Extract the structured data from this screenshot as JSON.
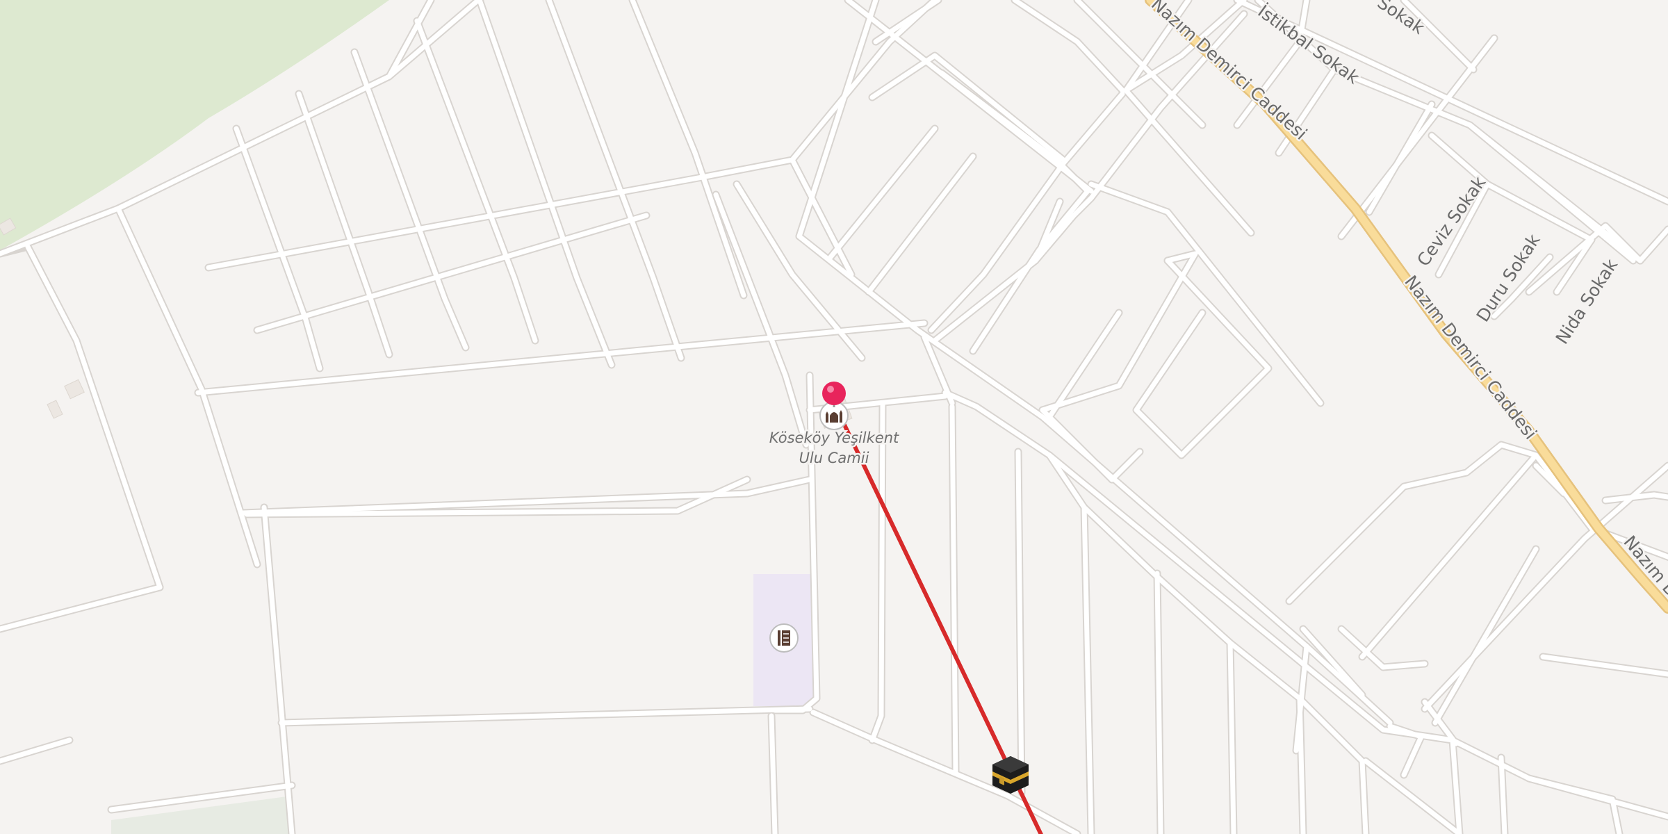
{
  "map": {
    "streets": [
      {
        "label": "Nazım Demirci Caddesi",
        "kind": "primary"
      },
      {
        "label": "Nazım Demirci Caddesi",
        "kind": "primary"
      },
      {
        "label": "Nazım D",
        "kind": "primary"
      },
      {
        "label": "İstikbal Sokak",
        "kind": "residential"
      },
      {
        "label": "Sokak",
        "kind": "residential"
      },
      {
        "label": "Ceviz Sokak",
        "kind": "residential"
      },
      {
        "label": "Duru Sokak",
        "kind": "residential"
      },
      {
        "label": "Nida Sokak",
        "kind": "residential"
      }
    ],
    "poi": {
      "name_line1": "Köseköy Yeşilkent",
      "name_line2": "Ulu Camii",
      "icon": "mosque-icon"
    },
    "school_icon": "school-icon",
    "qibla_icon": "kaaba-icon",
    "location_pin": "location-pin",
    "colors": {
      "background": "#f5f3f1",
      "park": "#dde9d0",
      "primary_road": "#f9dc9a",
      "qibla_line": "#d72a2a",
      "pin": "#e8245c",
      "school_area": "#ece6f4"
    }
  }
}
